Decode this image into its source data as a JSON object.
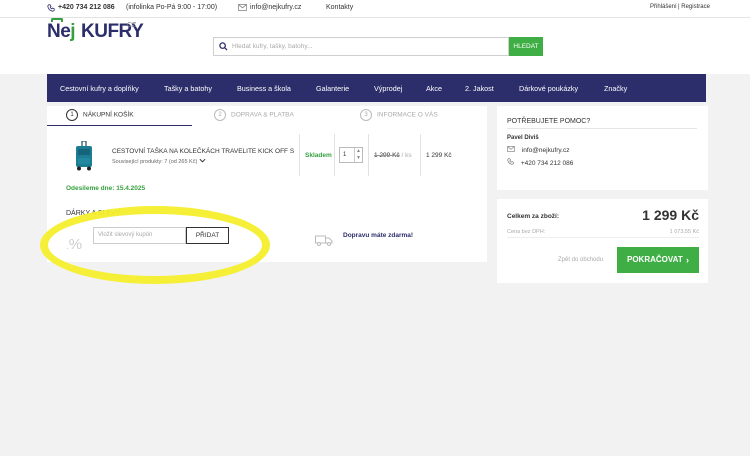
{
  "topbar": {
    "phone": "+420 734 212 086",
    "hours": "(infolinka Po-Pá 9:00 - 17:00)",
    "email": "info@nejkufry.cz",
    "contacts": "Kontakty",
    "login": "Přihlášení",
    "register": "Registrace"
  },
  "logo": {
    "part1": "Ne",
    "part2": "j",
    "part3": "KUFRY",
    "suffix": "CZ"
  },
  "search": {
    "placeholder": "Hledat kufry, tašky, batohy...",
    "button": "HLEDAT"
  },
  "nav": [
    "Cestovní kufry a doplňky",
    "Tašky a batohy",
    "Business a škola",
    "Galanterie",
    "Výprodej",
    "Akce",
    "2. Jakost",
    "Dárkové poukázky",
    "Značky"
  ],
  "steps": [
    {
      "num": "1",
      "label": "NÁKUPNÍ KOŠÍK"
    },
    {
      "num": "2",
      "label": "DOPRAVA & PLATBA"
    },
    {
      "num": "3",
      "label": "INFORMACE O VÁS"
    }
  ],
  "cart": {
    "product_name": "CESTOVNÍ TAŠKA NA KOLEČKÁCH TRAVELITE KICK OFF S",
    "related": "Související produkty: 7 (od 265 Kč)",
    "stock": "Skladem",
    "quantity": "1",
    "unit_price": "1 299 Kč",
    "unit_suffix": "/ ks",
    "total_price": "1 299 Kč",
    "ship_date": "Odesíleme dne: 15.4.2025"
  },
  "discount": {
    "title": "DÁRKY A SLEVY",
    "percent": "%",
    "coupon_placeholder": "Vložit slevový kupón",
    "add_button": "PŘIDAT",
    "free_shipping": "Dopravu máte zdarma!"
  },
  "help": {
    "title": "POTŘEBUJETE POMOC?",
    "name": "Pavel Diviš",
    "email": "info@nejkufry.cz",
    "phone": "+420 734 212 086"
  },
  "summary": {
    "total_label": "Celkem za zboží:",
    "total_value": "1 299 Kč",
    "vat_label": "Cena bez DPH:",
    "vat_value": "1 073,55 Kč",
    "back_link": "Zpět do obchodu",
    "continue_button": "POKRAČOVAT"
  },
  "colors": {
    "brand_navy": "#2c2d6b",
    "brand_green": "#3fae45",
    "highlight": "#f4ef2c"
  }
}
